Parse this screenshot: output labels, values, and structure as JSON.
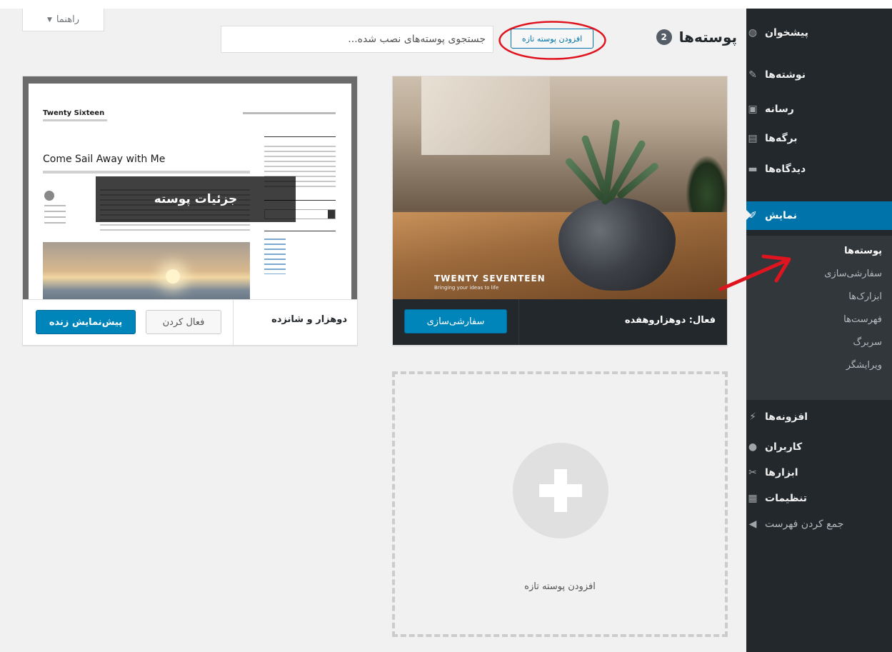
{
  "help": {
    "label": "راهنما",
    "chevron": "▼"
  },
  "header": {
    "title": "پوسته‌ها",
    "count": "2",
    "add_new": "افزودن پوسته تازه",
    "search_placeholder": "جستجوی پوسته‌های نصب شده..."
  },
  "sidebar": {
    "items": [
      {
        "label": "پیشخوان",
        "icon": "dashboard-icon"
      },
      {
        "label": "نوشته‌ها",
        "icon": "pin-icon"
      },
      {
        "label": "رسانه",
        "icon": "media-icon"
      },
      {
        "label": "برگه‌ها",
        "icon": "pages-icon"
      },
      {
        "label": "دیدگاه‌ها",
        "icon": "comments-icon"
      },
      {
        "label": "نمایش",
        "icon": "appearance-brush-icon"
      },
      {
        "label": "افزونه‌ها",
        "icon": "plugins-icon"
      },
      {
        "label": "کاربران",
        "icon": "users-icon"
      },
      {
        "label": "ابزارها",
        "icon": "tools-wrench-icon"
      },
      {
        "label": "تنظیمات",
        "icon": "settings-icon"
      },
      {
        "label": "جمع کردن فهرست",
        "icon": "collapse-icon"
      }
    ],
    "submenu": [
      "پوسته‌ها",
      "سفارشی‌سازی",
      "ابزارک‌ها",
      "فهرست‌ها",
      "سربرگ",
      "ویرایشگر"
    ],
    "active_color": "#0073aa",
    "bg_color": "#23282d"
  },
  "themes": {
    "seventeen": {
      "brand": "TWENTY SEVENTEEN",
      "tagline": "Bringing your ideas to life",
      "active_label": "فعال: دوهزاروهفده",
      "customize": "سفارشی‌سازی"
    },
    "sixteen": {
      "site_title": "Twenty Sixteen",
      "post_title": "Come Sail Away with Me",
      "details_overlay": "جزئیات پوسته",
      "name": "دوهزار و شانزده",
      "activate": "فعال کردن",
      "live_preview": "پیش‌نمایش زنده"
    },
    "add_new_label": "افزودن پوسته تازه"
  },
  "annotations": {
    "highlight_color": "#e0141e"
  }
}
